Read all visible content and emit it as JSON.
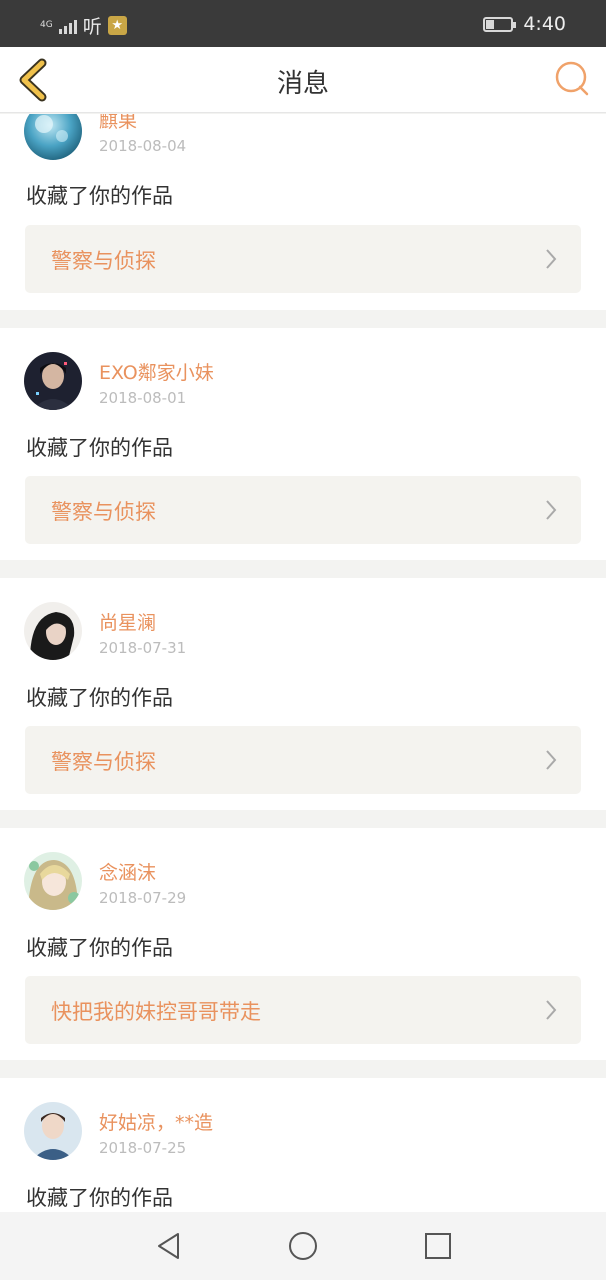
{
  "status_bar": {
    "network": "4G",
    "app_label": "听",
    "time": "4:40",
    "battery_level": 0.35,
    "colors": {
      "bg": "#3a3a3a",
      "notify": "#c9a646"
    }
  },
  "header": {
    "title": "消息",
    "back_icon": "chevron-left-icon",
    "search_icon": "search-icon",
    "colors": {
      "back": "#f0c14b",
      "search": "#f0a26a"
    }
  },
  "messages": [
    {
      "user": "麒果",
      "date": "2018-08-04",
      "action": "收藏了你的作品",
      "work_title": "警察与侦探",
      "avatar": "blue-bubbles-avatar"
    },
    {
      "user": "EXO鄰家小妹",
      "date": "2018-08-01",
      "action": "收藏了你的作品",
      "work_title": "警察与侦探",
      "avatar": "dark-portrait-avatar"
    },
    {
      "user": "尚星澜",
      "date": "2018-07-31",
      "action": "收藏了你的作品",
      "work_title": "警察与侦探",
      "avatar": "girl-dark-hair-avatar"
    },
    {
      "user": "念涵沫",
      "date": "2018-07-29",
      "action": "收藏了你的作品",
      "work_title": "快把我的妹控哥哥带走",
      "avatar": "anime-girl-avatar"
    },
    {
      "user": "好姑凉，**造",
      "date": "2018-07-25",
      "action": "收藏了你的作品",
      "work_title": "",
      "avatar": "boy-jersey-avatar"
    }
  ],
  "colors": {
    "accent": "#e9925e",
    "date": "#bcbcbc",
    "work_bg": "#f4f3ef",
    "page_bg": "#f3f3f1"
  },
  "nav": {
    "back": "triangle-back-icon",
    "home": "circle-home-icon",
    "recents": "square-recents-icon"
  }
}
